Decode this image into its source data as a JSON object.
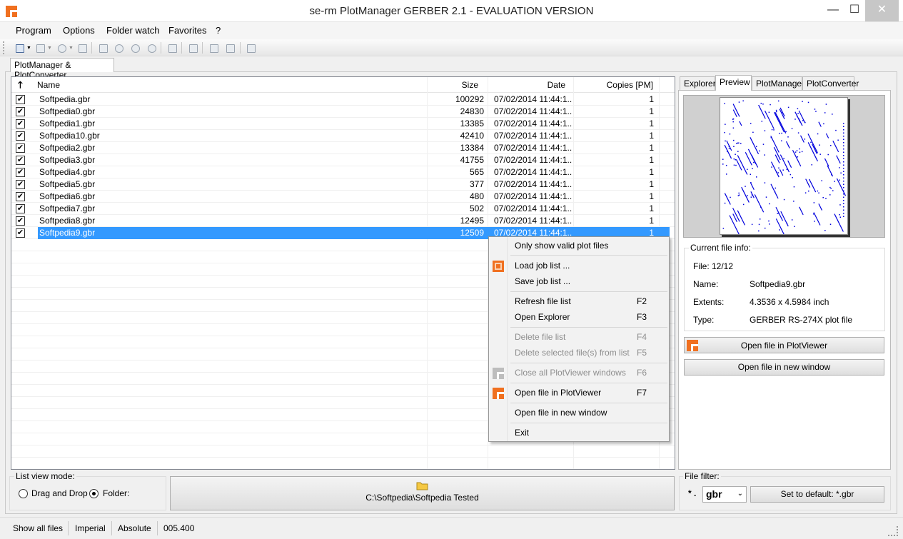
{
  "window": {
    "title": "se-rm PlotManager GERBER 2.1 - EVALUATION VERSION",
    "minimize": "—",
    "maximize": "☐",
    "close": "✕",
    "brand_color": "#f07020"
  },
  "menu": [
    "Program",
    "Options",
    "Folder watch",
    "Favorites",
    "?"
  ],
  "toolbar_icons": [
    "open-icon",
    "print-icon",
    "zoom-icon",
    "brush-icon",
    "page-icon",
    "zoom-fit-icon",
    "zoom-in-icon",
    "zoom-out-icon",
    "pan-icon",
    "window-icon",
    "undo-icon",
    "redo-icon",
    "r-icon"
  ],
  "main_tab": "PlotManager & PlotConverter",
  "filelist": {
    "sort_icon": "arrow-up-icon",
    "headers": {
      "name": "Name",
      "size": "Size",
      "date": "Date",
      "copies": "Copies [PM]"
    },
    "rows": [
      {
        "name": "Softpedia.gbr",
        "size": "100292",
        "date": "07/02/2014 11:44:1...",
        "copies": "1",
        "checked": "✔"
      },
      {
        "name": "Softpedia0.gbr",
        "size": "24830",
        "date": "07/02/2014 11:44:1...",
        "copies": "1",
        "checked": "✔"
      },
      {
        "name": "Softpedia1.gbr",
        "size": "13385",
        "date": "07/02/2014 11:44:1...",
        "copies": "1",
        "checked": "✔"
      },
      {
        "name": "Softpedia10.gbr",
        "size": "42410",
        "date": "07/02/2014 11:44:1...",
        "copies": "1",
        "checked": "✔"
      },
      {
        "name": "Softpedia2.gbr",
        "size": "13384",
        "date": "07/02/2014 11:44:1...",
        "copies": "1",
        "checked": "✔"
      },
      {
        "name": "Softpedia3.gbr",
        "size": "41755",
        "date": "07/02/2014 11:44:1...",
        "copies": "1",
        "checked": "✔"
      },
      {
        "name": "Softpedia4.gbr",
        "size": "565",
        "date": "07/02/2014 11:44:1...",
        "copies": "1",
        "checked": "✔"
      },
      {
        "name": "Softpedia5.gbr",
        "size": "377",
        "date": "07/02/2014 11:44:1...",
        "copies": "1",
        "checked": "✔"
      },
      {
        "name": "Softpedia6.gbr",
        "size": "480",
        "date": "07/02/2014 11:44:1...",
        "copies": "1",
        "checked": "✔"
      },
      {
        "name": "Softpedia7.gbr",
        "size": "502",
        "date": "07/02/2014 11:44:1...",
        "copies": "1",
        "checked": "✔"
      },
      {
        "name": "Softpedia8.gbr",
        "size": "12495",
        "date": "07/02/2014 11:44:1...",
        "copies": "1",
        "checked": "✔"
      },
      {
        "name": "Softpedia9.gbr",
        "size": "12509",
        "date": "07/02/2014 11:44:1...",
        "copies": "1",
        "checked": "✔",
        "selected": true
      }
    ]
  },
  "context_menu": {
    "items": [
      {
        "label": "Only show valid plot files",
        "shortcut": "",
        "disabled": false
      },
      {
        "label": "Load job list ...",
        "shortcut": "",
        "disabled": false,
        "icon": "job-list-icon"
      },
      {
        "label": "Save job list ...",
        "shortcut": "",
        "disabled": false
      },
      {
        "label": "Refresh file list",
        "shortcut": "F2",
        "disabled": false
      },
      {
        "label": "Open Explorer",
        "shortcut": "F3",
        "disabled": false
      },
      {
        "label": "Delete file list",
        "shortcut": "F4",
        "disabled": true
      },
      {
        "label": "Delete selected file(s) from list",
        "shortcut": "F5",
        "disabled": true
      },
      {
        "label": "Close all PlotViewer windows",
        "shortcut": "F6",
        "disabled": true,
        "icon": "plotviewer-icon-gray"
      },
      {
        "label": "Open file in PlotViewer",
        "shortcut": "F7",
        "disabled": false,
        "icon": "plotviewer-icon"
      },
      {
        "label": "Open file in new window",
        "shortcut": "",
        "disabled": false
      },
      {
        "label": "Exit",
        "shortcut": "",
        "disabled": false
      }
    ]
  },
  "right_tabs": [
    "Explorer",
    "Preview",
    "PlotManager",
    "PlotConverter"
  ],
  "active_right_tab": "Preview",
  "fileinfo": {
    "legend": "Current file info:",
    "file": "File: 12/12",
    "name_label": "Name:",
    "name": "Softpedia9.gbr",
    "extents_label": "Extents:",
    "extents": "4.3536 x 4.5984 inch",
    "type_label": "Type:",
    "type": "GERBER RS-274X plot file"
  },
  "buttons": {
    "open_plotviewer": "Open file in PlotViewer",
    "open_new_window": "Open file in new window",
    "set_default": "Set to default: *.gbr"
  },
  "list_view_mode": {
    "legend": "List view mode:",
    "drag_drop": "Drag and Drop",
    "folder": "Folder:"
  },
  "folder_path": "C:\\Softpedia\\Softpedia Tested",
  "file_filter": {
    "legend": "File filter:",
    "prefix": "* .",
    "value": "gbr"
  },
  "status": [
    "Show all files",
    "Imperial",
    "Absolute",
    "005.400"
  ],
  "trace_color": "#0000dd"
}
